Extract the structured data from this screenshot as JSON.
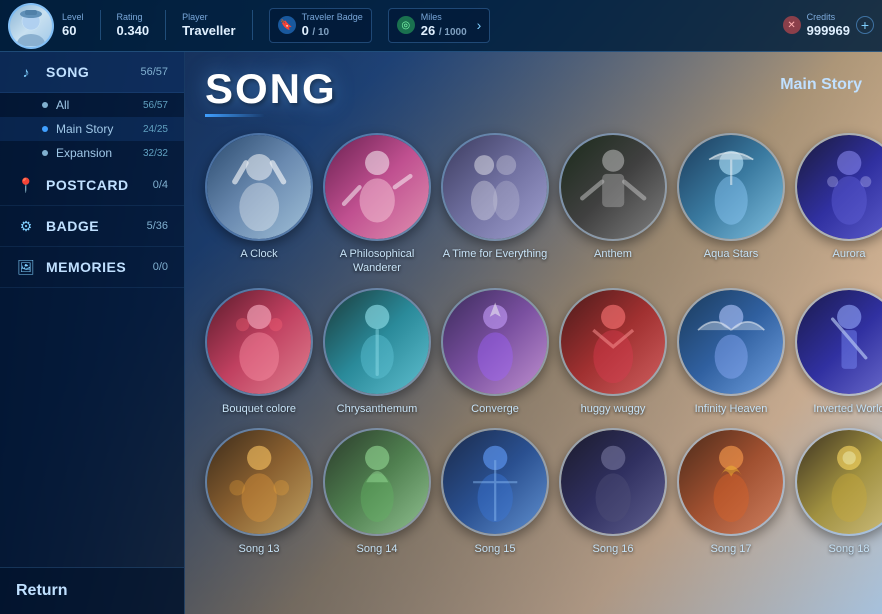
{
  "header": {
    "level_label": "Level",
    "level_value": "60",
    "rating_label": "Rating",
    "rating_value": "0.340",
    "player_label": "Player",
    "player_name": "Traveller",
    "traveler_badge_label": "Traveler Badge",
    "traveler_badge_value": "0",
    "traveler_badge_max": "/ 10",
    "miles_label": "Miles",
    "miles_value": "26",
    "miles_max": "/ 1000",
    "credits_label": "Credits",
    "credits_value": "999969",
    "add_label": "+"
  },
  "sidebar": {
    "song_label": "SONG",
    "song_count": "56/57",
    "all_label": "All",
    "all_count": "56/57",
    "main_story_label": "Main Story",
    "main_story_count": "24/25",
    "expansion_label": "Expansion",
    "expansion_count": "32/32",
    "postcard_label": "POSTCARD",
    "postcard_count": "0/4",
    "badge_label": "BADGE",
    "badge_count": "5/36",
    "memories_label": "MEMORIES",
    "memories_count": "0/0",
    "return_label": "Return"
  },
  "main": {
    "title": "SONG",
    "category": "Main Story",
    "songs": [
      {
        "name": "A Clock",
        "color_class": "c1"
      },
      {
        "name": "A Philosophical Wanderer",
        "color_class": "c2"
      },
      {
        "name": "A Time for Everything",
        "color_class": "c3"
      },
      {
        "name": "Anthem",
        "color_class": "c4"
      },
      {
        "name": "Aqua Stars",
        "color_class": "c5"
      },
      {
        "name": "Aurora",
        "color_class": "c6"
      },
      {
        "name": "Bouquet colore",
        "color_class": "c7"
      },
      {
        "name": "Chrysanthemum",
        "color_class": "c8"
      },
      {
        "name": "Converge",
        "color_class": "c9"
      },
      {
        "name": "huggy wuggy",
        "color_class": "c10"
      },
      {
        "name": "Infinity Heaven",
        "color_class": "c11"
      },
      {
        "name": "Inverted World",
        "color_class": "c12"
      },
      {
        "name": "Song 13",
        "color_class": "c13"
      },
      {
        "name": "Song 14",
        "color_class": "c14"
      },
      {
        "name": "Song 15",
        "color_class": "c15"
      },
      {
        "name": "Song 16",
        "color_class": "c16"
      },
      {
        "name": "Song 17",
        "color_class": "c17"
      },
      {
        "name": "Song 18",
        "color_class": "c18"
      }
    ]
  }
}
